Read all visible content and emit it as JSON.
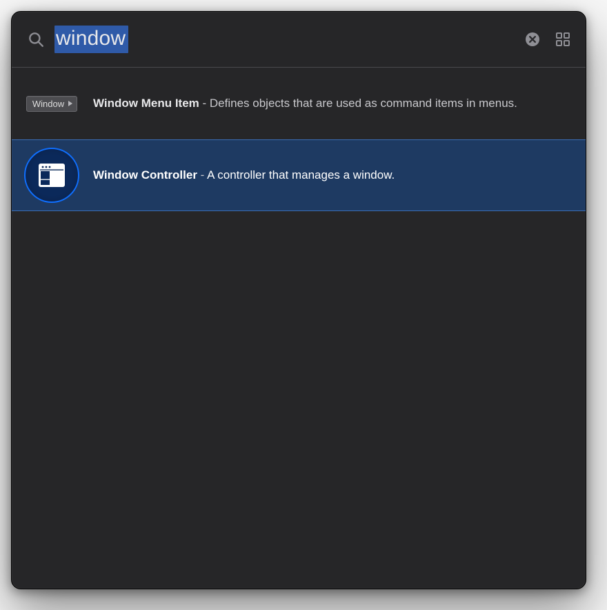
{
  "search": {
    "value": "window",
    "placeholder": "",
    "selected": true
  },
  "toolbar": {
    "clear_icon": "clear",
    "grid_icon": "grid"
  },
  "results": [
    {
      "id": "window-menu-item",
      "title": "Window Menu Item",
      "separator": " - ",
      "description": "Defines objects that are used as command items in menus.",
      "chip_label": "Window",
      "thumb_kind": "menu-chip",
      "selected": false
    },
    {
      "id": "window-controller",
      "title": "Window Controller",
      "separator": " - ",
      "description": "A controller that manages a window.",
      "thumb_kind": "window-controller-ring",
      "selected": true
    }
  ]
}
